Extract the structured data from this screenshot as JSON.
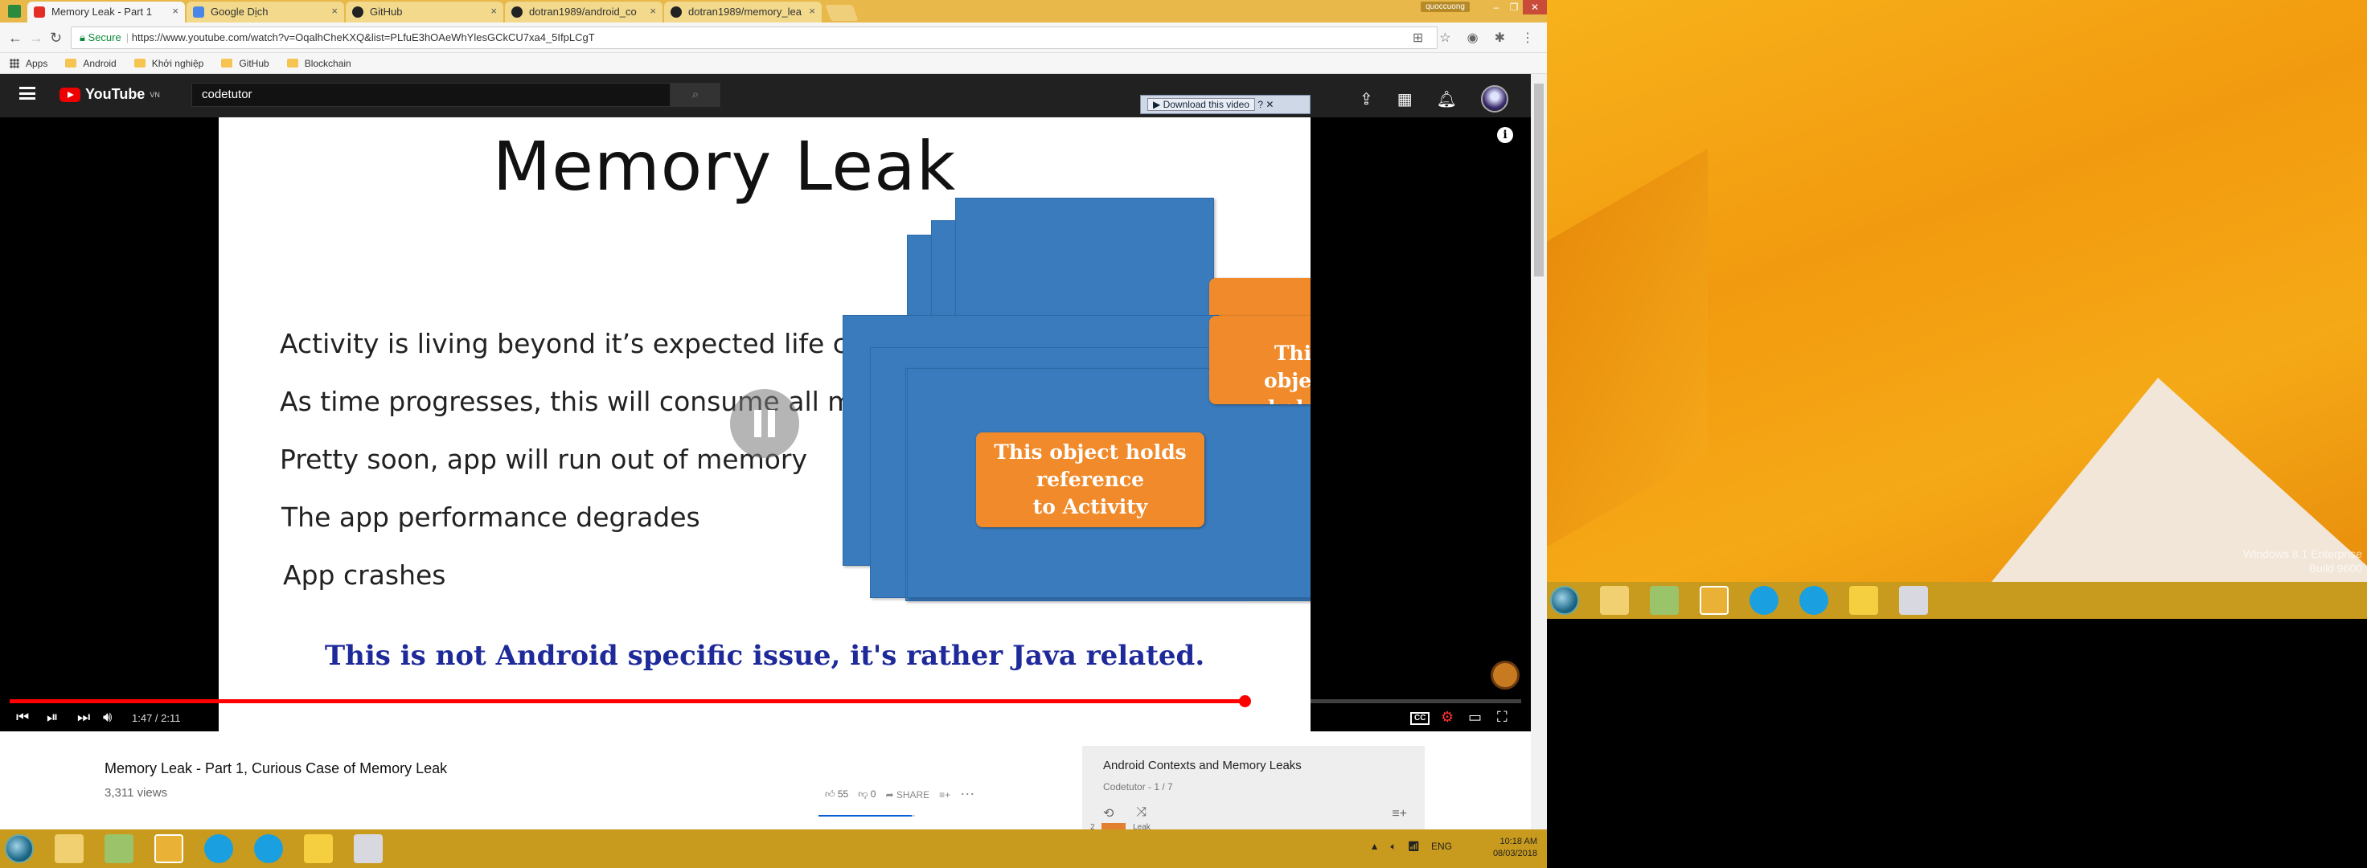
{
  "browser": {
    "tabs": [
      {
        "label": "Memory Leak - Part 1",
        "favicon_color": "#e52d27"
      },
      {
        "label": "Google Dịch",
        "favicon_color": "#4a86e8"
      },
      {
        "label": "GitHub",
        "favicon_color": "#222222"
      },
      {
        "label": "dotran1989/android_co",
        "favicon_color": "#222222"
      },
      {
        "label": "dotran1989/memory_lea",
        "favicon_color": "#222222"
      }
    ],
    "profile_name": "quoccuong",
    "secure_label": "Secure",
    "url": "https://www.youtube.com/watch?v=OqalhCheKXQ&list=PLfuE3hOAeWhYlesGCkCU7xa4_5IfpLCgT",
    "bookmarks": [
      "Apps",
      "Android",
      "Khởi nghiệp",
      "GitHub",
      "Blockchain"
    ]
  },
  "youtube": {
    "logo_text": "YouTube",
    "logo_region": "VN",
    "search_value": "codetutor",
    "download_banner": "Download this video",
    "slide": {
      "title": "Memory Leak",
      "bullets": [
        "Activity is living beyond it’s expected life cycle",
        "As  time progresses, this will consume all memory",
        "Pretty soon, app will run out of memory",
        "The app performance degrades",
        "App crashes"
      ],
      "card_back_text": "This\nobject\nholds",
      "card_front_text": "This object holds\nreference\nto Activity",
      "footer": "This is not Android specific issue, it's rather Java related."
    },
    "player": {
      "time": "1:47 / 2:11",
      "progress": 0.817
    },
    "video": {
      "title": "Memory Leak - Part 1, Curious Case of Memory Leak",
      "views": "3,311 views",
      "likes": "55",
      "dislikes": "0",
      "share": "SHARE"
    },
    "playlist": {
      "title": "Android Contexts and Memory Leaks",
      "subtitle": "Codetutor - 1 / 7",
      "next_index": "2",
      "next_label": "Leak"
    }
  },
  "taskbar": {
    "language": "ENG",
    "time": "10:18 AM",
    "date": "08/03/2018"
  },
  "desktop": {
    "watermark_line1": "Windows 8.1 Enterprise",
    "watermark_line2": "Build 9600"
  },
  "colors": {
    "youtube_red": "#ff0000",
    "slide_blue_card": "#3a7bbd",
    "slide_orange": "#f08a2a",
    "footer_blue": "#1f2a9a",
    "taskbar": "#c89a1e"
  }
}
